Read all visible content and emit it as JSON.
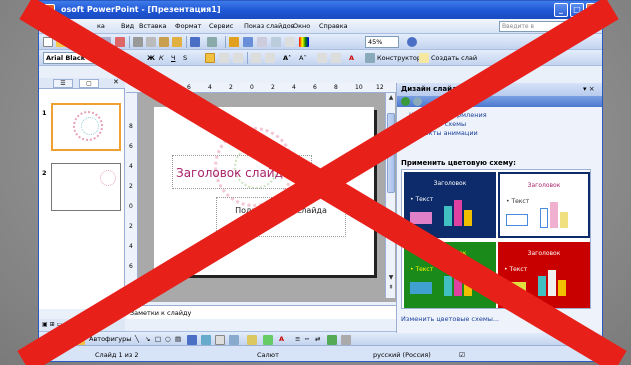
{
  "window": {
    "title": "Microsoft PowerPoint - [Презентация1]",
    "title_visible": "osoft PowerPoint - [Презентация1]"
  },
  "menu": {
    "items": [
      "ка",
      "Вид",
      "Вставка",
      "Формат",
      "Сервис",
      "Показ слайдов",
      "Окно",
      "Справка"
    ],
    "help_placeholder": "Введите в"
  },
  "format_toolbar": {
    "font": "Arial Black",
    "designer": "Конструктор",
    "new_slide": "Создать слай"
  },
  "standard_toolbar": {
    "zoom": "45%"
  },
  "left_panel": {
    "slides": [
      {
        "number": "1"
      },
      {
        "number": "2"
      }
    ]
  },
  "ruler": {
    "h": [
      "8",
      "6",
      "4",
      "2",
      "0",
      "2",
      "4",
      "6",
      "8",
      "10",
      "12"
    ],
    "v": [
      "8",
      "6",
      "4",
      "2",
      "0",
      "2",
      "4",
      "6",
      "8"
    ]
  },
  "slide": {
    "title": "Заголовок слайда",
    "subtitle": "Подзаголовок слайда"
  },
  "notes": {
    "text": "Заметки к слайду"
  },
  "drawing_toolbar": {
    "draw": "Дей",
    "autoshapes": "Автофигуры"
  },
  "status": {
    "slide": "Слайд 1 из 2",
    "design": "Салют",
    "language": "русский (Россия)"
  },
  "task_pane": {
    "title": "Дизайн слайд",
    "links": [
      "Шаблоны оформления",
      "Цветовые схемы",
      "Эффекты анимации"
    ],
    "apply_label": "Применить цветовую схему:",
    "schemes": [
      {
        "title": "Заголовок",
        "text": "• Текст",
        "bg": "#0d2b6b",
        "fg": "#ffffff"
      },
      {
        "title": "Заголовок",
        "text": "• Текст",
        "bg": "#ffffff",
        "fg": "#a8246b"
      },
      {
        "title": "Заголовок",
        "text": "• Текст",
        "bg": "#1a8a1a",
        "fg": "#ffff00"
      },
      {
        "title": "Заголовок",
        "text": "• Текст",
        "bg": "#c80000",
        "fg": "#ffffff"
      }
    ],
    "footer": "Изменить цветовые схемы..."
  },
  "colors": {
    "accent": "#2b59c3",
    "cross": "#e8201a",
    "orange": "#f49a2c"
  }
}
